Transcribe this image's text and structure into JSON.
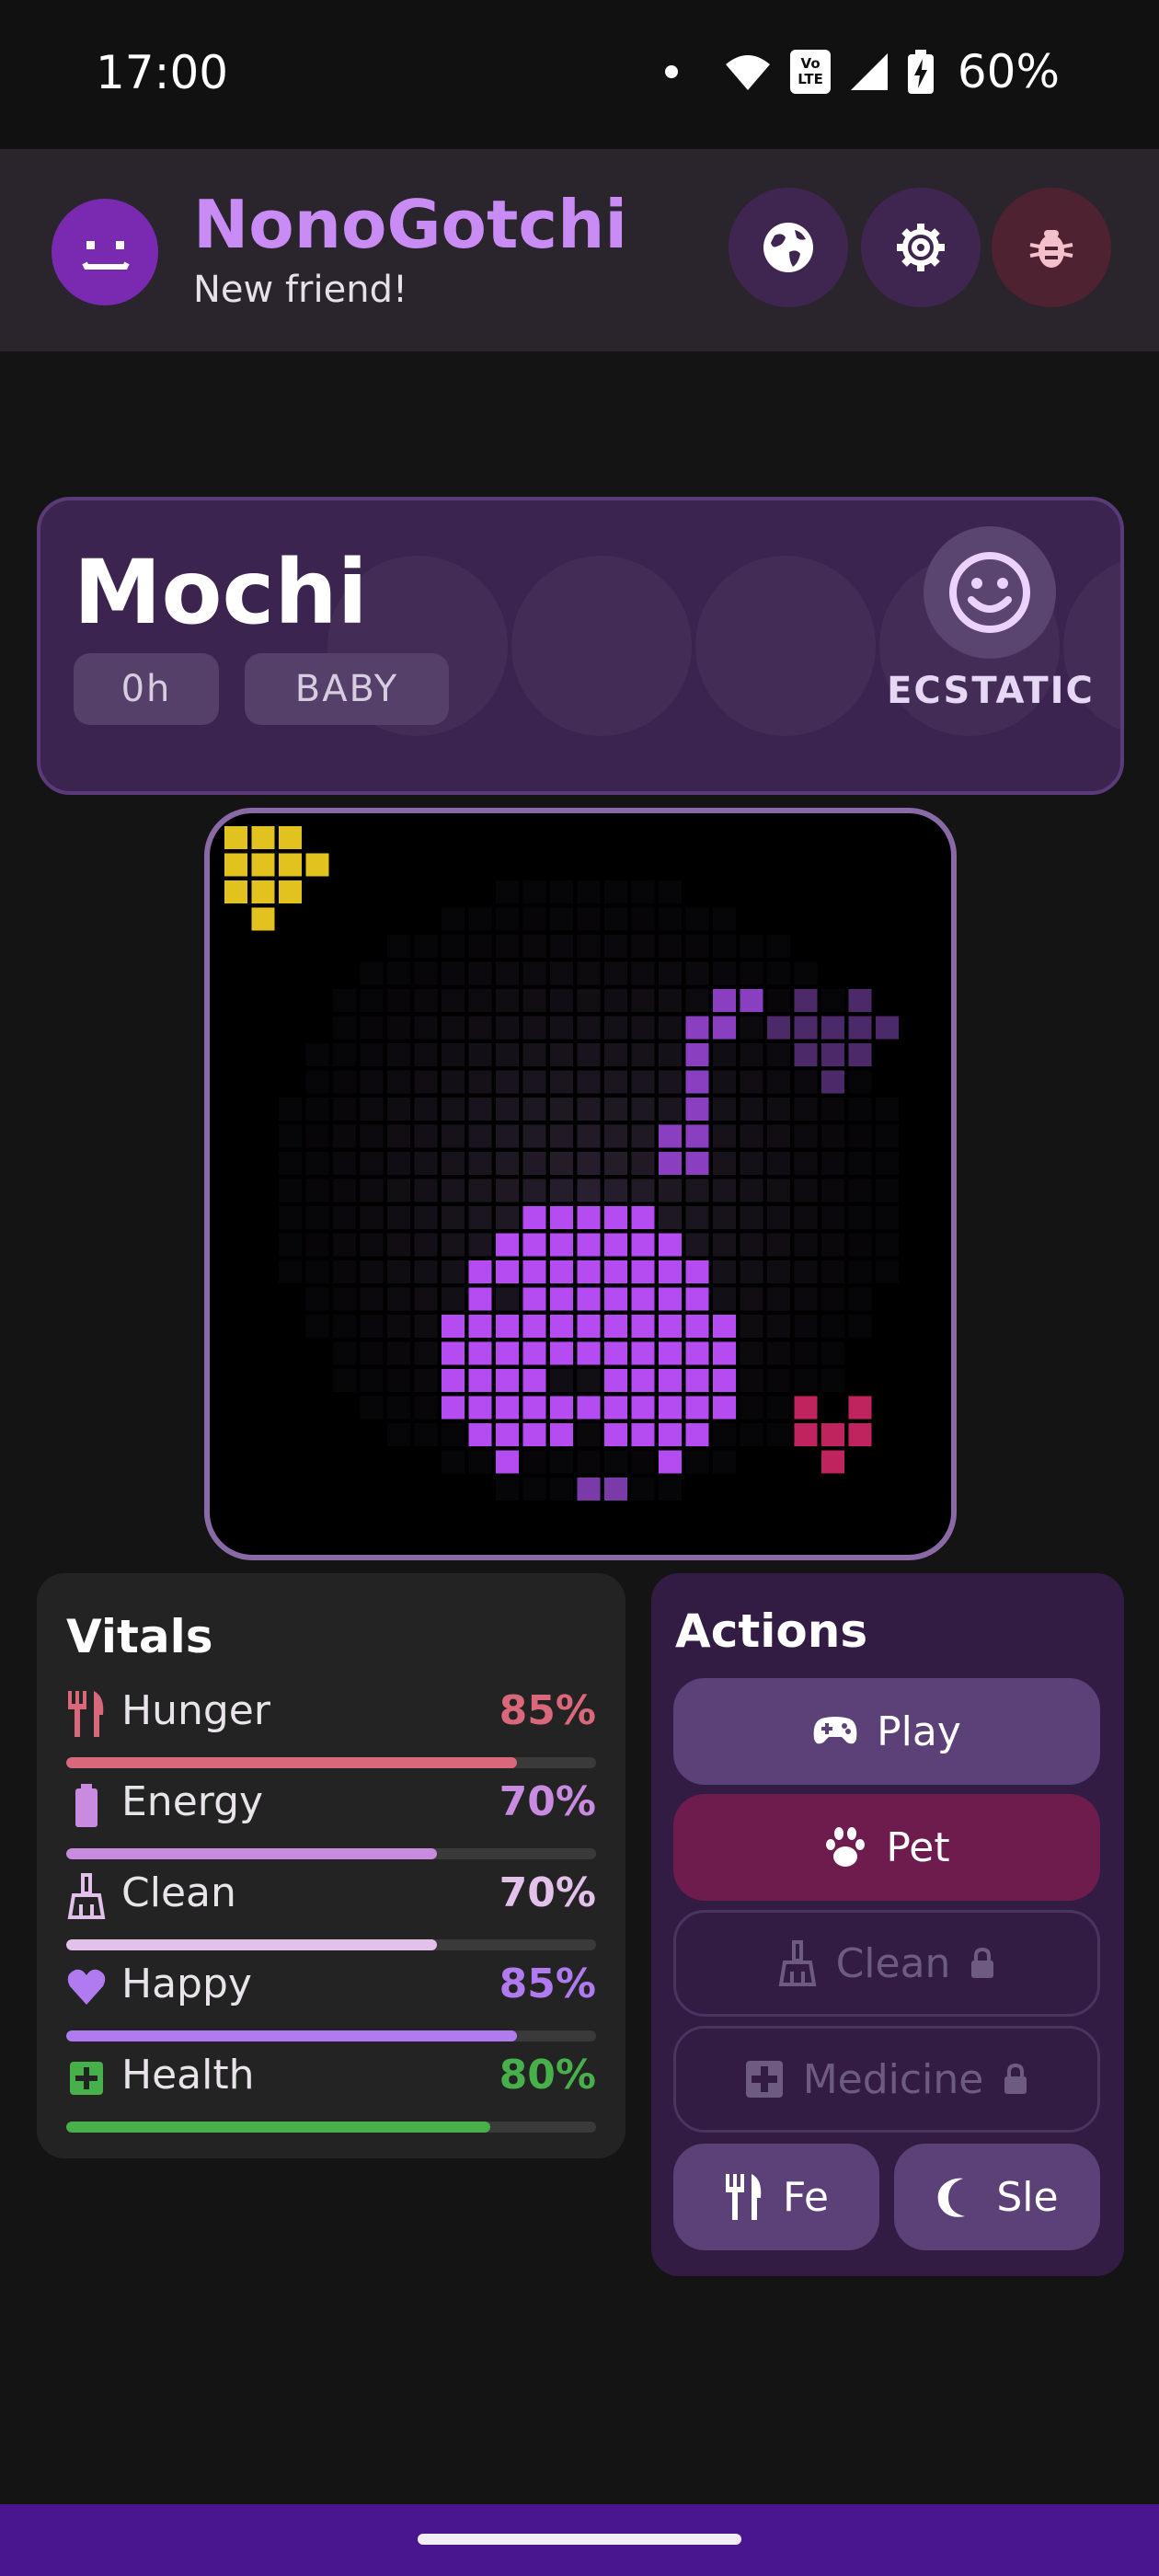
{
  "status": {
    "time": "17:00",
    "volte_top": "Vo",
    "volte_bottom": "LTE",
    "battery": "60%"
  },
  "app": {
    "title": "NonoGotchi",
    "subtitle": "New friend!",
    "icons": {
      "logo": "robot-face-icon",
      "language": "globe-icon",
      "settings": "gear-icon",
      "debug": "bug-icon"
    }
  },
  "pet": {
    "name": "Mochi",
    "age": "0h",
    "stage": "BABY",
    "mood": "ECSTATIC",
    "mood_icon": "smiley-face-icon"
  },
  "vitals": {
    "title": "Vitals",
    "items": [
      {
        "label": "Hunger",
        "value": "85%",
        "level": 0.85,
        "color": "#d9687a",
        "icon": "fork-knife-icon"
      },
      {
        "label": "Energy",
        "value": "70%",
        "level": 0.7,
        "color": "#c98be0",
        "icon": "battery-icon"
      },
      {
        "label": "Clean",
        "value": "70%",
        "level": 0.7,
        "color": "#e2c2ea",
        "icon": "broom-icon"
      },
      {
        "label": "Happy",
        "value": "85%",
        "level": 0.85,
        "color": "#b07af0",
        "icon": "heart-icon"
      },
      {
        "label": "Health",
        "value": "80%",
        "level": 0.8,
        "color": "#47b04b",
        "icon": "medical-cross-icon"
      }
    ]
  },
  "actions": {
    "title": "Actions",
    "play": "Play",
    "pet": "Pet",
    "clean": "Clean",
    "medicine": "Medicine",
    "feed": "Fe",
    "sleep": "Sle"
  },
  "colors": {
    "accent": "#c98cf5",
    "pet_pixel": "#b44cf2",
    "star": "#e2c21e",
    "heart": "#c0245e"
  }
}
